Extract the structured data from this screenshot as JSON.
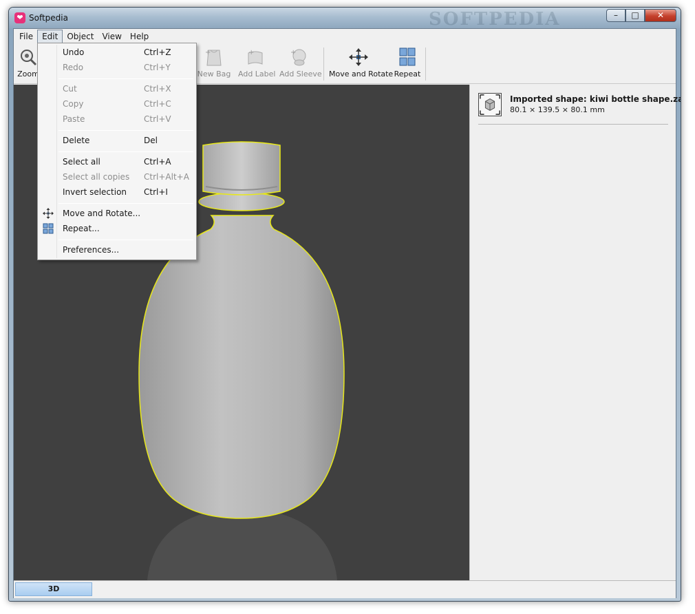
{
  "window": {
    "title": "Softpedia",
    "title_watermark": "SOFTPEDIA",
    "controls": {
      "minimize": "–",
      "maximize": "□",
      "close": "✕"
    }
  },
  "menubar": {
    "items": [
      {
        "label": "File"
      },
      {
        "label": "Edit",
        "active": true
      },
      {
        "label": "Object"
      },
      {
        "label": "View"
      },
      {
        "label": "Help"
      }
    ]
  },
  "toolbar": {
    "tools": [
      {
        "label": "Zoom",
        "icon": "zoom-icon"
      },
      {
        "label": "New Bag",
        "icon": "bag-icon",
        "disabled": true
      },
      {
        "label": "Add Label",
        "icon": "label-icon",
        "disabled": true
      },
      {
        "label": "Add Sleeve",
        "icon": "sleeve-icon",
        "disabled": true
      },
      {
        "label": "Move and Rotate",
        "icon": "move-rotate-icon"
      },
      {
        "label": "Repeat",
        "icon": "repeat-grid-icon"
      }
    ]
  },
  "edit_menu": {
    "items": [
      {
        "label": "Undo",
        "shortcut": "Ctrl+Z"
      },
      {
        "label": "Redo",
        "shortcut": "Ctrl+Y",
        "disabled": true
      },
      {
        "label": "Cut",
        "shortcut": "Ctrl+X",
        "disabled": true
      },
      {
        "label": "Copy",
        "shortcut": "Ctrl+C",
        "disabled": true
      },
      {
        "label": "Paste",
        "shortcut": "Ctrl+V",
        "disabled": true
      },
      {
        "label": "Delete",
        "shortcut": "Del"
      },
      {
        "label": "Select all",
        "shortcut": "Ctrl+A"
      },
      {
        "label": "Select all copies",
        "shortcut": "Ctrl+Alt+A",
        "disabled": true
      },
      {
        "label": "Invert selection",
        "shortcut": "Ctrl+I"
      },
      {
        "label": "Move and Rotate...",
        "shortcut": "",
        "icon": "move-rotate-icon"
      },
      {
        "label": "Repeat...",
        "shortcut": "",
        "icon": "repeat-grid-icon"
      },
      {
        "label": "Preferences...",
        "shortcut": ""
      }
    ]
  },
  "side_panel": {
    "shape_title": "Imported shape: kiwi bottle shape.zae",
    "shape_dims": "80.1 × 139.5 × 80.1 mm",
    "thumb_icon": "cube-icon"
  },
  "statusbar": {
    "tab_label": "3D"
  },
  "colors": {
    "viewport_bg": "#404040",
    "selection_outline": "#e8e81a",
    "status_tab": "#a9cdf0"
  }
}
